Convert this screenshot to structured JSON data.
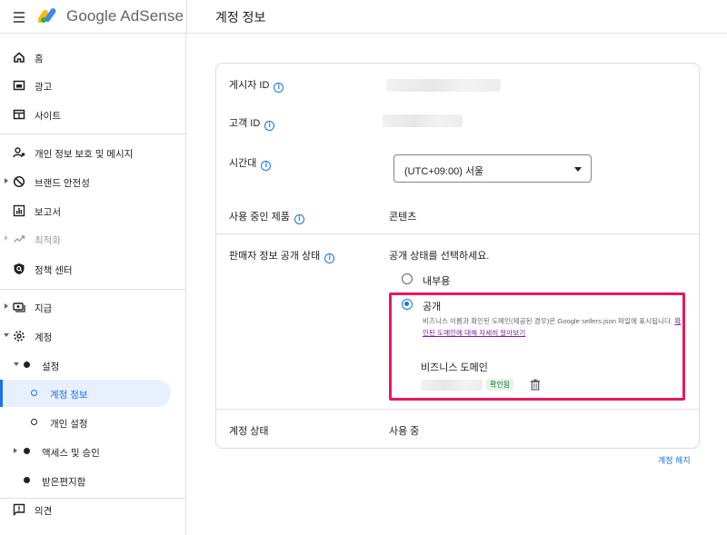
{
  "header": {
    "brand": "Google AdSense",
    "page_title": "계정 정보"
  },
  "sidebar": {
    "items": [
      {
        "label": "홈",
        "icon": "home-icon"
      },
      {
        "label": "광고",
        "icon": "ads-icon"
      },
      {
        "label": "사이트",
        "icon": "sites-icon"
      },
      {
        "label": "개인 정보 보호 및 메시지",
        "icon": "privacy-messaging-icon"
      },
      {
        "label": "브랜드 안전성",
        "icon": "block-icon"
      },
      {
        "label": "보고서",
        "icon": "reports-icon"
      },
      {
        "label": "최적화",
        "icon": "trending-icon"
      },
      {
        "label": "정책 센터",
        "icon": "policy-shield-icon"
      },
      {
        "label": "지급",
        "icon": "payments-icon"
      },
      {
        "label": "계정",
        "icon": "gear-icon"
      },
      {
        "label": "설정"
      },
      {
        "label": "계정 정보"
      },
      {
        "label": "개인 설정"
      },
      {
        "label": "액세스 및 승인"
      },
      {
        "label": "받은편지함"
      },
      {
        "label": "의견",
        "icon": "feedback-icon"
      }
    ]
  },
  "account": {
    "publisher_id_label": "게시자 ID",
    "customer_id_label": "고객 ID",
    "timezone_label": "시간대",
    "timezone_value": "(UTC+09:00) 서울",
    "products_label": "사용 중인 제품",
    "products_value": "콘텐츠",
    "seller_label": "판매자 정보 공개 상태",
    "seller_prompt": "공개 상태를 선택하세요.",
    "option_internal": "내부용",
    "option_public": "공개",
    "public_desc": "비즈니스 이름과 확인된 도메인(제공된 경우)은 Google sellers.json 파일에 표시됩니다.",
    "public_link": "확인된 도메인에 대해 자세히 알아보기",
    "business_domain_label": "비즈니스 도메인",
    "verified_badge": "확인됨",
    "status_label": "계정 상태",
    "status_value": "사용 중"
  },
  "footer": {
    "terminate_label": "계정 해지"
  },
  "colors": {
    "accent": "#1a73e8",
    "highlight_border": "#e8185e",
    "verified_bg": "#e6f4ea"
  }
}
